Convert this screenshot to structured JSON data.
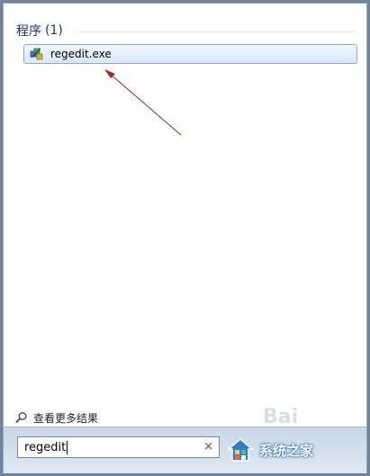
{
  "start_menu": {
    "section": {
      "title": "程序",
      "count": "(1)"
    },
    "results": [
      {
        "label": "regedit.exe",
        "icon": "regedit-icon"
      }
    ],
    "see_more": {
      "label": "查看更多结果",
      "icon": "search-icon"
    },
    "search": {
      "value": "regedit",
      "clear_symbol": "×"
    }
  },
  "watermark": {
    "text": "Bai",
    "brand": "系统之家"
  },
  "colors": {
    "arrow": "#a3281e",
    "section_title": "#1e3287",
    "highlight_border": "#84acdd"
  }
}
